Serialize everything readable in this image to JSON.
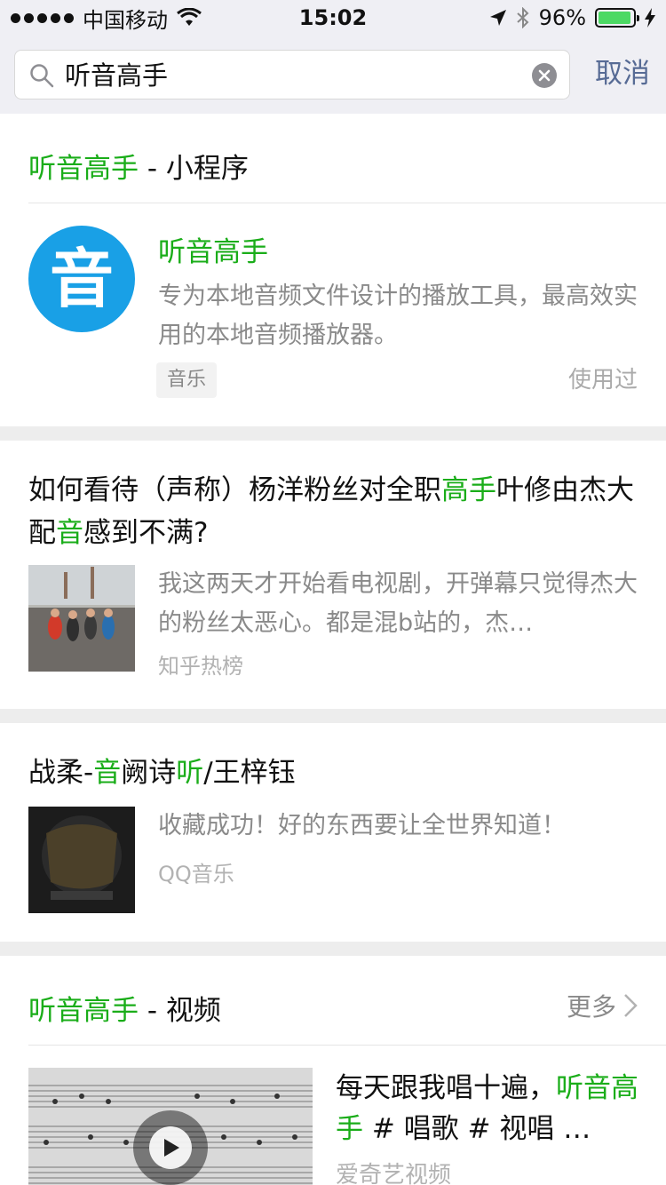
{
  "status_bar": {
    "carrier": "中国移动",
    "time": "15:02",
    "battery": "96%",
    "battery_level": 0.96
  },
  "search": {
    "query": "听音高手",
    "cancel_label": "取消"
  },
  "mini_program_section": {
    "title_hl": "听音高手",
    "title_rest": " - 小程序",
    "app": {
      "logo_char": "音",
      "name": "听音高手",
      "description": "专为本地音频文件设计的播放工具，最高效实用的本地音频播放器。",
      "tag": "音乐",
      "status": "使用过"
    }
  },
  "articles": [
    {
      "title_parts": [
        "如何看待（声称）杨洋粉丝对全职",
        "高手",
        "叶修由杰大配",
        "音",
        "感到不满?"
      ],
      "snippet": "我这两天才开始看电视剧，开弹幕只觉得杰大的粉丝太恶心。都是混b站的，杰…",
      "source": "知乎热榜"
    },
    {
      "title_parts": [
        "战柔-",
        "音",
        "阙诗",
        "听",
        "/王梓钰"
      ],
      "snippet": "收藏成功！好的东西要让全世界知道！",
      "source": "QQ音乐"
    }
  ],
  "video_section": {
    "title_hl": "听音高手",
    "title_rest": " - 视频",
    "more_label": "更多",
    "video": {
      "title_parts": [
        "每天跟我唱十遍，",
        "听音",
        "高手",
        " # 唱歌 # 视唱 …"
      ],
      "source": "爱奇艺视频"
    }
  },
  "colors": {
    "highlight": "#1aad19",
    "link": "#576b95",
    "logo_bg": "#19a0e6"
  }
}
